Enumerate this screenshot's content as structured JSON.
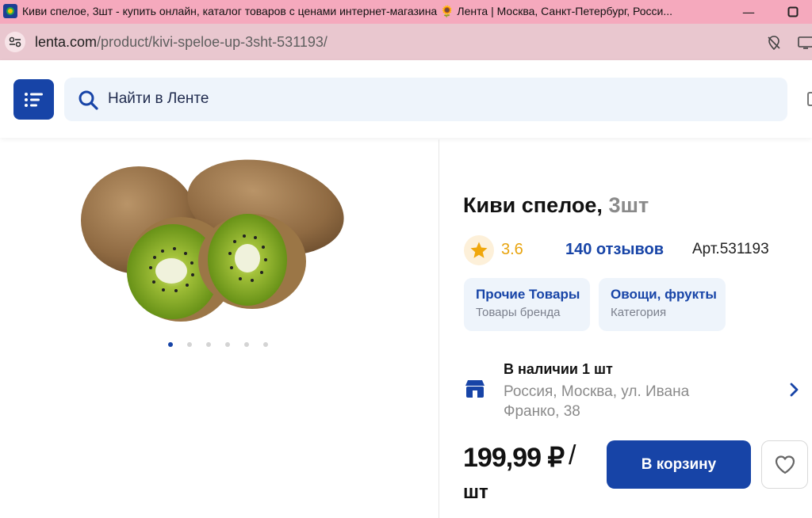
{
  "browser": {
    "tab_title": "Киви спелое, 3шт - купить онлайн, каталог товаров с ценами интернет-магазина 🌻 Лента | Москва, Санкт-Петербург, Росси...",
    "url_host": "lenta.com",
    "url_path": "/product/kivi-speloe-up-3sht-531193/",
    "minimize_glyph": "—",
    "maximize_glyph": "☐"
  },
  "header": {
    "search_placeholder": "Найти в Ленте"
  },
  "product": {
    "name": "Киви спелое,",
    "unit_label": "3шт",
    "rating": "3.6",
    "reviews": "140 отзывов",
    "article": "Арт.531193",
    "gallery_dots": 6,
    "gallery_active_index": 0,
    "chips": [
      {
        "title": "Прочие Товары",
        "subtitle": "Товары бренда"
      },
      {
        "title": "Овощи, фрукты",
        "subtitle": "Категория"
      }
    ],
    "availability": "В наличии 1 шт",
    "store_address": "Россия, Москва, ул. Ивана Франко, 38",
    "price": "199,99 ₽",
    "price_separator": "/",
    "price_unit": "шт",
    "add_to_cart": "В корзину"
  },
  "colors": {
    "brand_blue": "#1744a7",
    "rating_orange": "#e8a40f",
    "chip_bg": "#eef4fb",
    "titlebar_pink": "#f5a9bd"
  },
  "icons": {
    "menu": "list-menu-icon",
    "search": "search-icon",
    "star": "star-icon",
    "store": "store-icon",
    "chevron": "chevron-right-icon",
    "heart": "heart-icon"
  }
}
